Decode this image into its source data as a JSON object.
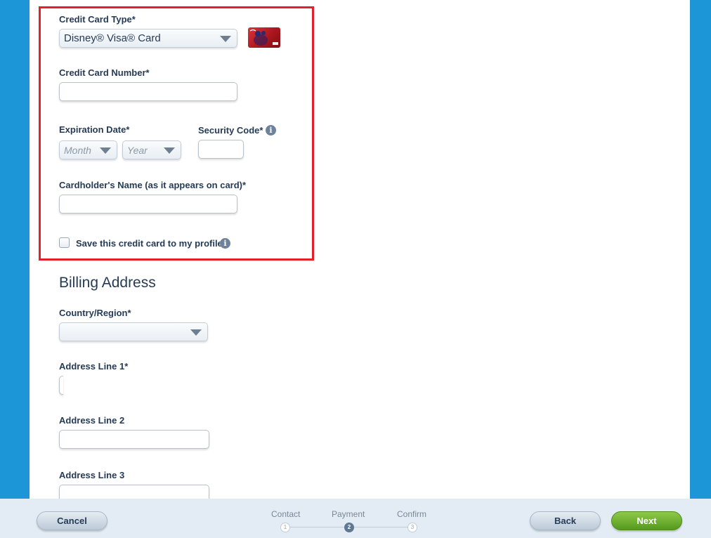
{
  "payment": {
    "card_type_label": "Credit Card Type*",
    "card_type_value": "Disney® Visa® Card",
    "card_image_icon": "disney-visa-card-image",
    "card_number_label": "Credit Card Number*",
    "card_number_value": "",
    "expiration_label": "Expiration Date*",
    "month_placeholder": "Month",
    "year_placeholder": "Year",
    "security_code_label": "Security Code*",
    "security_code_value": "",
    "cardholder_label": "Cardholder's Name (as it appears on card)*",
    "cardholder_value": "",
    "save_card_label": "Save this credit card to my profile.",
    "save_card_checked": false,
    "highlight_color": "#e5202a"
  },
  "billing": {
    "heading": "Billing Address",
    "country_label": "Country/Region*",
    "country_value": "",
    "address1_label": "Address Line 1*",
    "address1_value": "",
    "address2_label": "Address Line 2",
    "address2_value": "",
    "address3_label": "Address Line 3",
    "address3_value": ""
  },
  "footer": {
    "cancel_label": "Cancel",
    "back_label": "Back",
    "next_label": "Next",
    "steps": [
      {
        "label": "Contact",
        "number": "1",
        "active": false
      },
      {
        "label": "Payment",
        "number": "2",
        "active": true
      },
      {
        "label": "Confirm",
        "number": "3",
        "active": false
      }
    ]
  },
  "colors": {
    "background": "#1d96d8",
    "next_button": "#6cae2e",
    "text": "#253b56"
  }
}
